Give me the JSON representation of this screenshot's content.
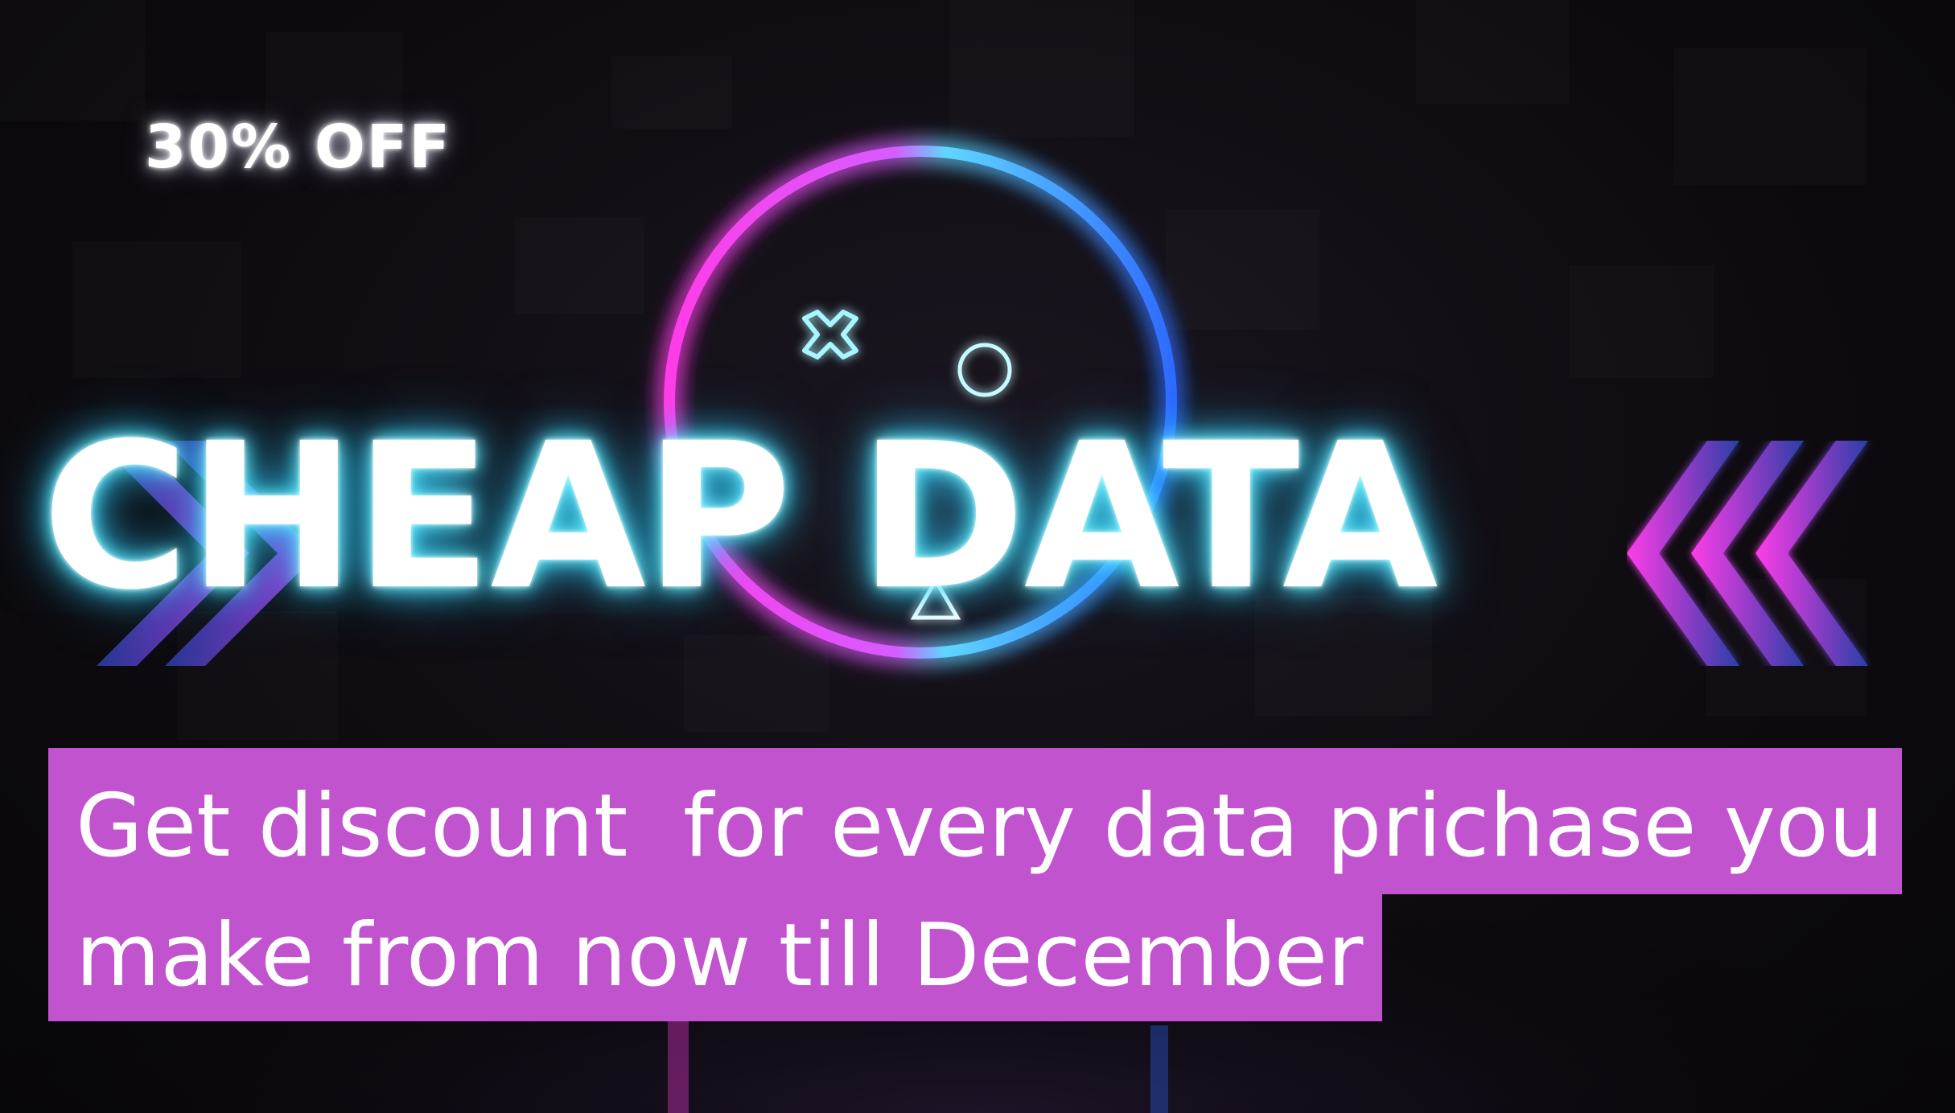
{
  "banner": {
    "badge": "30% OFF",
    "headline": "CHEAP DATA",
    "tagline": {
      "line1": "Get discount  for every data prichase you",
      "line2": "make from now till December"
    }
  },
  "colors": {
    "tagline_bg": "#c153cf",
    "neon_pink": "#ff3ce8",
    "neon_blue": "#2f6bff",
    "neon_cyan": "#35e6ff",
    "background": "#0b090d"
  },
  "icons": [
    "neon-circle-ring",
    "cross-icon",
    "circle-icon",
    "triangle-icon",
    "chevrons-right-icon",
    "chevrons-left-icon"
  ]
}
